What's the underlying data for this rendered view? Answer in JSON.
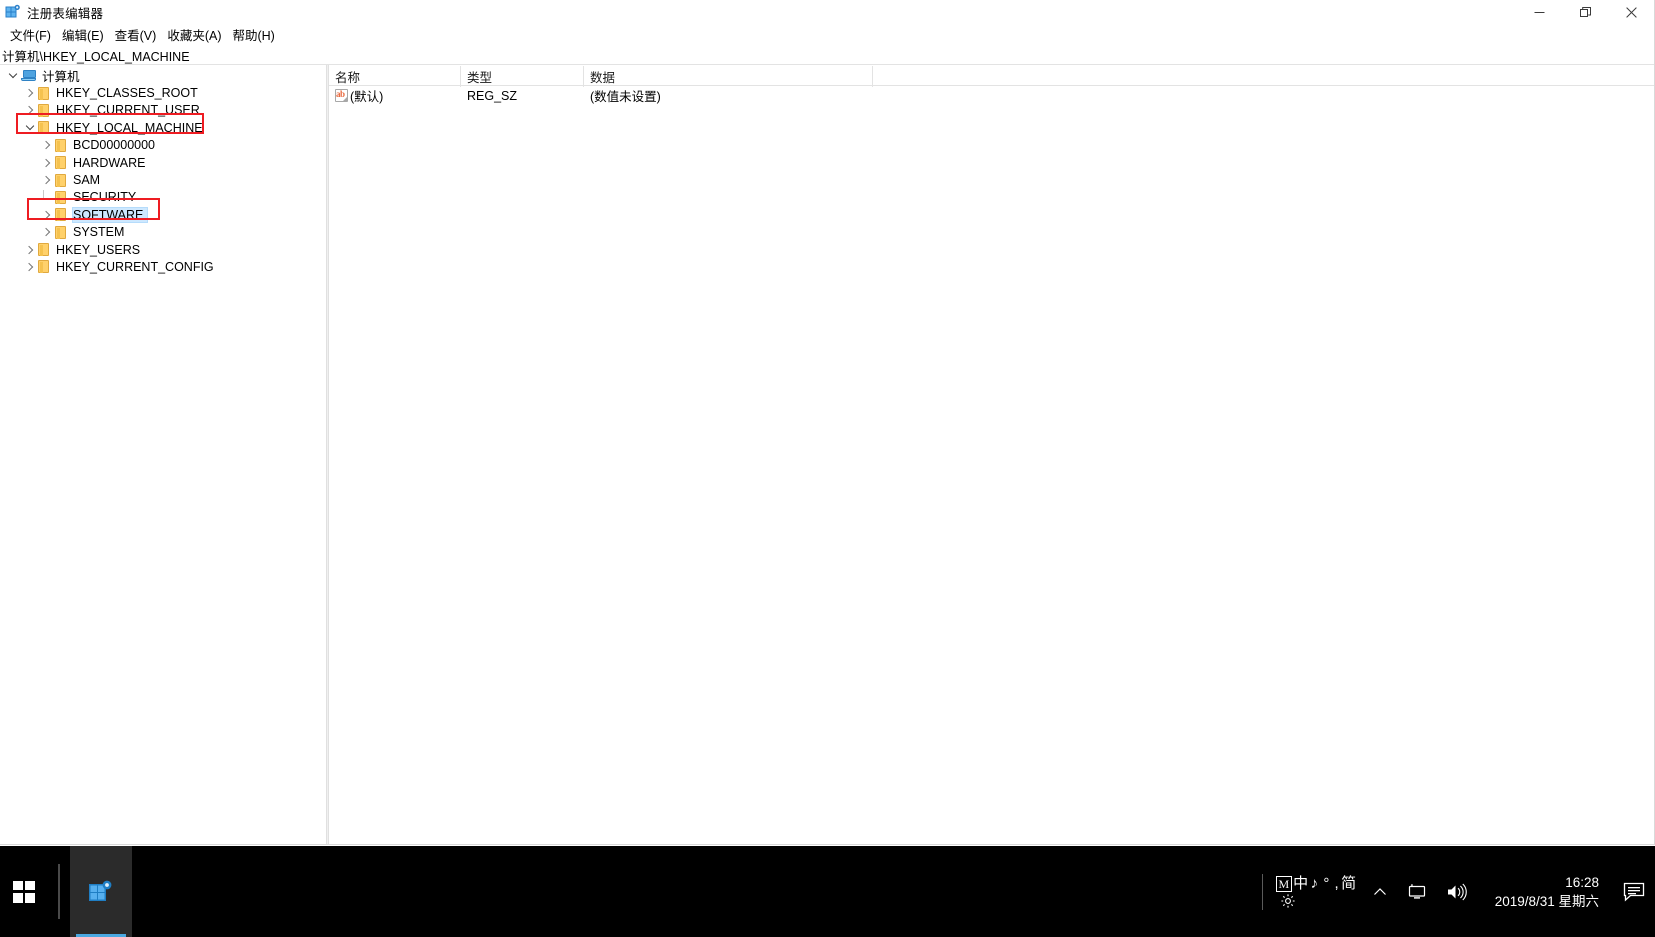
{
  "window": {
    "title": "注册表编辑器",
    "icon": "regedit-icon",
    "controls": {
      "minimize": "minimize-icon",
      "maximize": "restore-icon",
      "close": "close-icon"
    }
  },
  "menubar": {
    "items": [
      {
        "label": "文件(F)",
        "name": "menu-file"
      },
      {
        "label": "编辑(E)",
        "name": "menu-edit"
      },
      {
        "label": "查看(V)",
        "name": "menu-view"
      },
      {
        "label": "收藏夹(A)",
        "name": "menu-favorites"
      },
      {
        "label": "帮助(H)",
        "name": "menu-help"
      }
    ]
  },
  "address": {
    "path": "计算机\\HKEY_LOCAL_MACHINE"
  },
  "tree": {
    "items": [
      {
        "label": "计算机",
        "indent": 0,
        "state": "expanded",
        "icon": "computer-icon",
        "selected": false
      },
      {
        "label": "HKEY_CLASSES_ROOT",
        "indent": 1,
        "state": "collapsed",
        "icon": "folder-icon",
        "selected": false
      },
      {
        "label": "HKEY_CURRENT_USER",
        "indent": 1,
        "state": "collapsed",
        "icon": "folder-icon",
        "selected": false
      },
      {
        "label": "HKEY_LOCAL_MACHINE",
        "indent": 1,
        "state": "expanded",
        "icon": "folder-icon",
        "selected": false
      },
      {
        "label": "BCD00000000",
        "indent": 2,
        "state": "collapsed",
        "icon": "folder-icon",
        "selected": false
      },
      {
        "label": "HARDWARE",
        "indent": 2,
        "state": "collapsed",
        "icon": "folder-icon",
        "selected": false
      },
      {
        "label": "SAM",
        "indent": 2,
        "state": "collapsed",
        "icon": "folder-icon",
        "selected": false
      },
      {
        "label": "SECURITY",
        "indent": 2,
        "state": "leaf",
        "icon": "folder-icon",
        "selected": false
      },
      {
        "label": "SOFTWARE",
        "indent": 2,
        "state": "collapsed",
        "icon": "folder-icon",
        "selected": true
      },
      {
        "label": "SYSTEM",
        "indent": 2,
        "state": "collapsed",
        "icon": "folder-icon",
        "selected": false
      },
      {
        "label": "HKEY_USERS",
        "indent": 1,
        "state": "collapsed",
        "icon": "folder-icon",
        "selected": false
      },
      {
        "label": "HKEY_CURRENT_CONFIG",
        "indent": 1,
        "state": "collapsed",
        "icon": "folder-icon",
        "selected": false
      }
    ]
  },
  "list": {
    "columns": [
      {
        "label": "名称",
        "name": "column-name"
      },
      {
        "label": "类型",
        "name": "column-type"
      },
      {
        "label": "数据",
        "name": "column-data"
      }
    ],
    "rows": [
      {
        "name": "(默认)",
        "type": "REG_SZ",
        "data": "(数值未设置)",
        "icon": "string-value-icon"
      }
    ]
  },
  "annotations": {
    "highlight_color": "#ee1c22",
    "boxes": [
      {
        "target": "HKEY_LOCAL_MACHINE",
        "name": "annotation-box-hklm"
      },
      {
        "target": "SOFTWARE",
        "name": "annotation-box-software"
      }
    ]
  },
  "taskbar": {
    "start": "windows-start-icon",
    "pinned": [
      {
        "name": "taskbar-regedit",
        "icon": "regedit-icon",
        "active": true
      }
    ],
    "tray": {
      "ime": {
        "mode_badge": "M",
        "language": "中",
        "symbols": "♪ ° ,",
        "script": "简",
        "settings_icon": "gear-icon"
      },
      "show_hidden": "chevron-up-icon",
      "icons": [
        {
          "name": "network-icon",
          "glyph": "monitor"
        },
        {
          "name": "volume-icon",
          "glyph": "speaker"
        }
      ],
      "clock": {
        "time": "16:28",
        "date": "2019/8/31 星期六"
      },
      "action_center": "action-center-icon"
    }
  }
}
